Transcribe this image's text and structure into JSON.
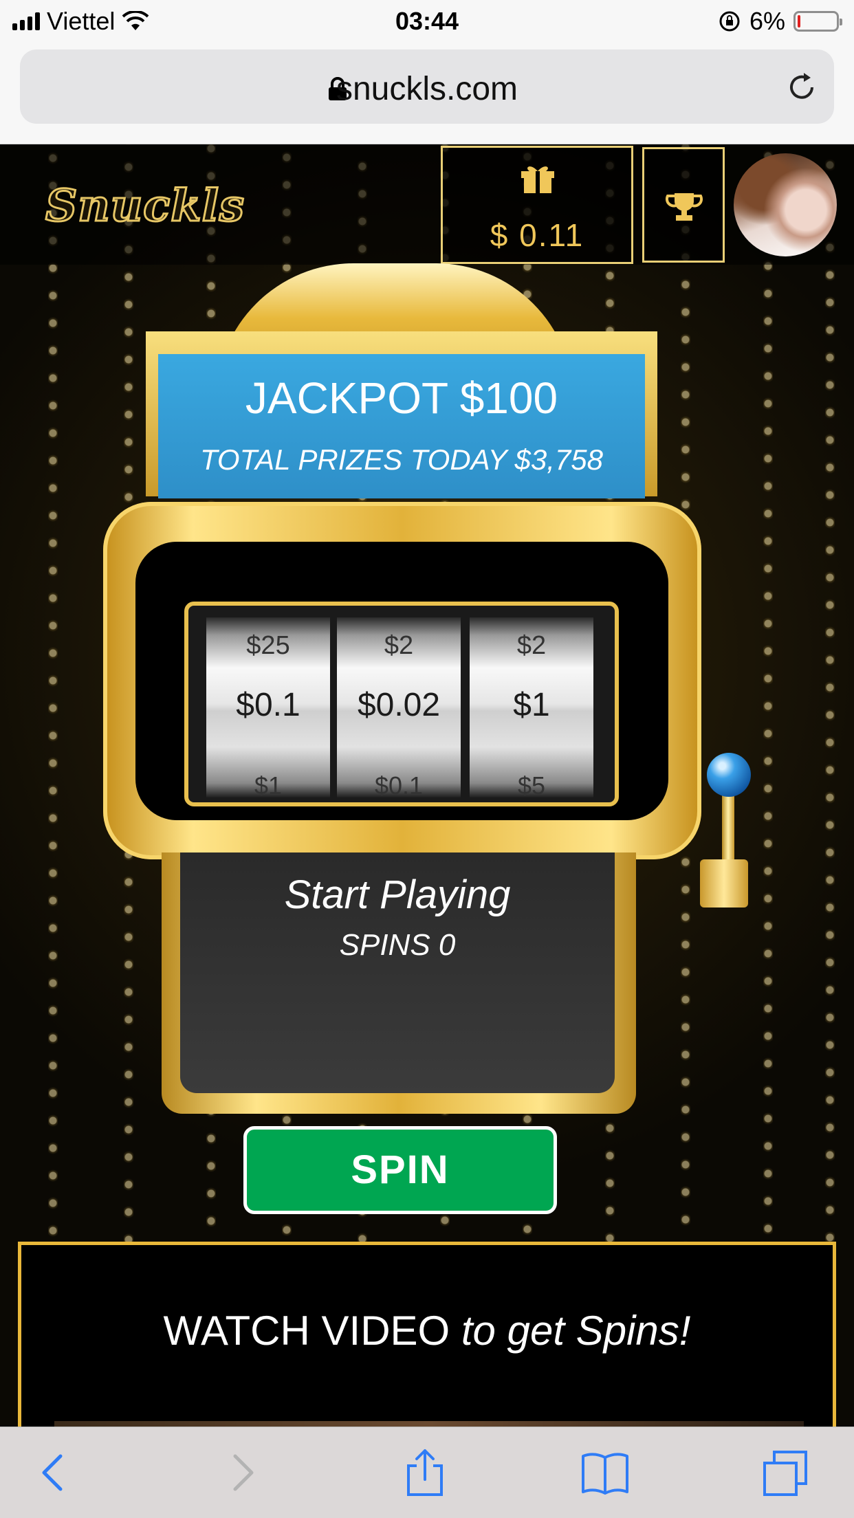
{
  "status_bar": {
    "carrier": "Viettel",
    "time": "03:44",
    "battery": "6%",
    "battery_level": 0.06
  },
  "address_bar": {
    "url": "snuckls.com"
  },
  "header": {
    "logo": "Snuckls",
    "balance": "$ 0.11"
  },
  "machine": {
    "jackpot": "JACKPOT $100",
    "total_prizes": "TOTAL PRIZES TODAY $3,758",
    "reels": [
      {
        "top": "$25",
        "middle": "$0.1",
        "bottom": "$1"
      },
      {
        "top": "$2",
        "middle": "$0.02",
        "bottom": "$0.1"
      },
      {
        "top": "$2",
        "middle": "$1",
        "bottom": "$5"
      }
    ],
    "start_label": "Start Playing",
    "spins_label": "SPINS 0",
    "spin_button": "SPIN"
  },
  "watch_video": {
    "text_main": "WATCH VIDEO",
    "text_italic": "to get Spins!"
  },
  "icons": {
    "gift": "gift-icon",
    "trophy": "trophy-icon",
    "lock": "lock-icon",
    "reload": "reload-icon",
    "back": "chevron-left-icon",
    "forward": "chevron-right-icon",
    "share": "share-icon",
    "bookmarks": "book-icon",
    "tabs": "tabs-icon"
  },
  "colors": {
    "gold": "#e9c04e",
    "sign_blue": "#3aa8e0",
    "spin_green": "#00a651",
    "ios_blue": "#2f7cf6"
  }
}
